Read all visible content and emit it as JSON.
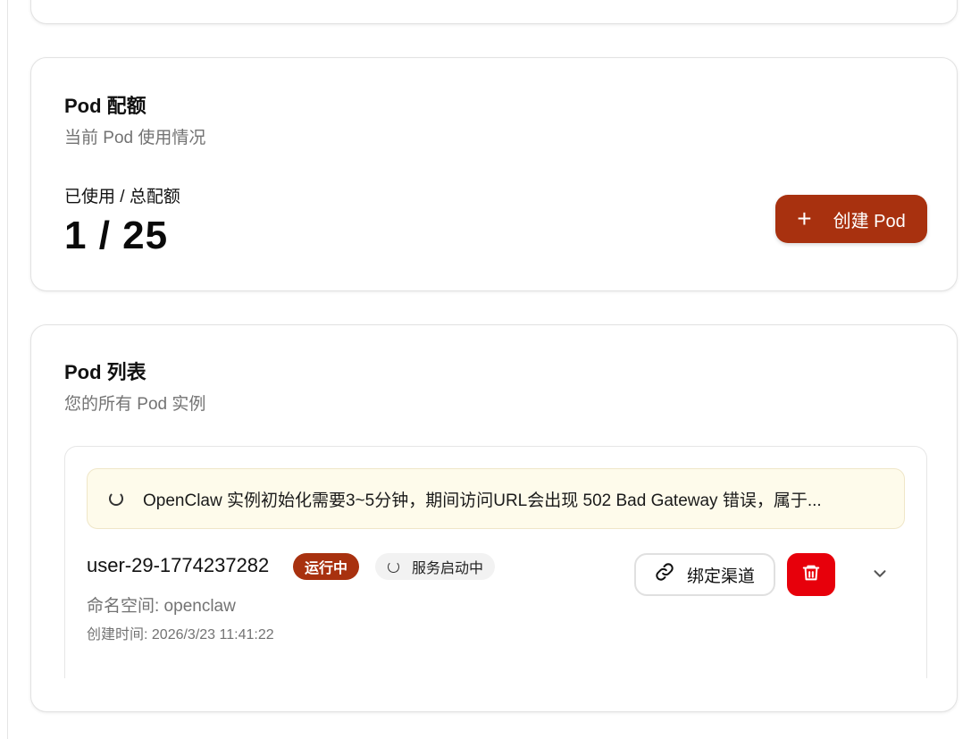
{
  "quota": {
    "title": "Pod 配额",
    "subtitle": "当前 Pod 使用情况",
    "usage_label": "已使用 / 总配额",
    "usage_value": "1 / 25",
    "create_button_label": "创建 Pod"
  },
  "pod_list": {
    "title": "Pod 列表",
    "subtitle": "您的所有 Pod 实例",
    "notice": "OpenClaw 实例初始化需要3~5分钟，期间访问URL会出现 502 Bad Gateway 错误，属于...",
    "pods": [
      {
        "name": "user-29-1774237282",
        "status": "运行中",
        "service_status": "服务启动中",
        "namespace": "命名空间: openclaw",
        "created_at": "创建时间: 2026/3/23 11:41:22",
        "bind_button_label": "绑定渠道"
      }
    ]
  },
  "colors": {
    "primary": "#a8310f",
    "danger": "#e7000b",
    "muted_text": "#737373",
    "notice_bg": "#fefbeb"
  },
  "icons": {
    "create": "plus-icon",
    "loading": "spinner-icon",
    "bind": "link-icon",
    "delete": "trash-icon",
    "expand": "chevron-down-icon"
  }
}
